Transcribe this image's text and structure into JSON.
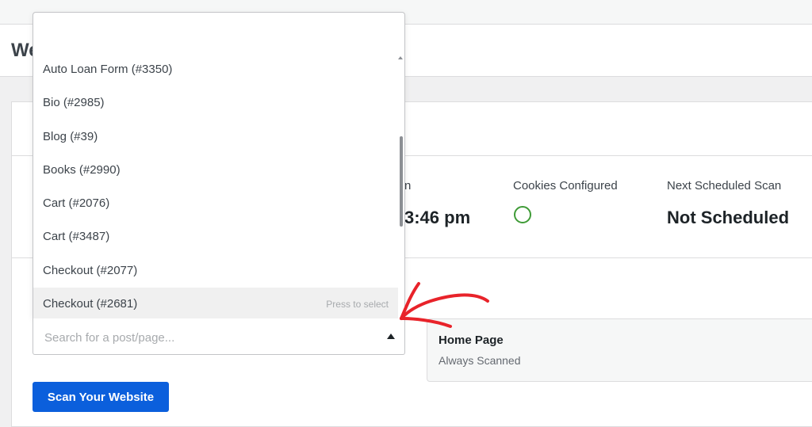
{
  "page": {
    "title": "We"
  },
  "stats": {
    "last_scan_label_fragment": "n",
    "last_scan_value_fragment": "3:46 pm",
    "cookies_label": "Cookies Configured",
    "cookies_icon": "circle-icon",
    "next_scan_label": "Next Scheduled Scan",
    "next_scan_value": "Not Scheduled"
  },
  "home_page": {
    "title": "Home Page",
    "subtitle": "Always Scanned"
  },
  "search": {
    "placeholder": "Search for a post/page..."
  },
  "dropdown": {
    "items": [
      {
        "label": "Auto Loan Form (#3350)"
      },
      {
        "label": "Bio (#2985)"
      },
      {
        "label": "Blog (#39)"
      },
      {
        "label": "Books (#2990)"
      },
      {
        "label": "Cart (#2076)"
      },
      {
        "label": "Cart (#3487)"
      },
      {
        "label": "Checkout (#2077)"
      },
      {
        "label": "Checkout (#2681)",
        "hint": "Press to select"
      }
    ]
  },
  "scan_button": {
    "label": "Scan Your Website"
  },
  "colors": {
    "accent": "#0b5fdc",
    "annotation_arrow": "#e8232a",
    "success": "#3f9b37"
  }
}
